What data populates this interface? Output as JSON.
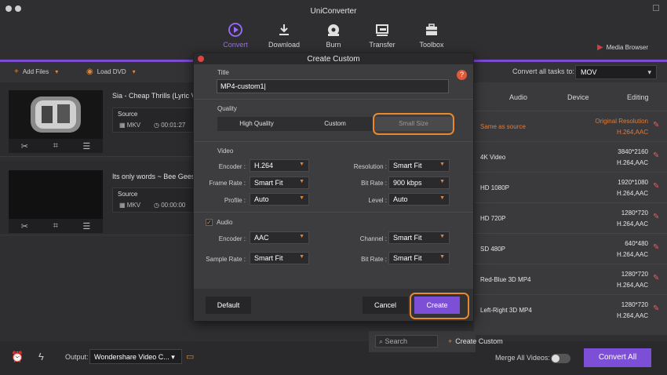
{
  "app": {
    "title": "UniConverter",
    "media_browser": "Media Browser"
  },
  "toolbar": [
    {
      "label": "Convert",
      "icon": "convert-icon",
      "active": true
    },
    {
      "label": "Download",
      "icon": "download-icon",
      "active": false
    },
    {
      "label": "Burn",
      "icon": "burn-icon",
      "active": false
    },
    {
      "label": "Transfer",
      "icon": "transfer-icon",
      "active": false
    },
    {
      "label": "Toolbox",
      "icon": "toolbox-icon",
      "active": false
    }
  ],
  "actionbar": {
    "add_files": "Add Files",
    "load_dvd": "Load DVD",
    "convert_all_label": "Convert all tasks to:",
    "convert_all_value": "MOV"
  },
  "videos": [
    {
      "title": "Sia - Cheap Thrills (Lyric V",
      "source_label": "Source",
      "format": "MKV",
      "duration": "00:01:27"
    },
    {
      "title": "Its only words ~ Bee Gees",
      "source_label": "Source",
      "format": "MKV",
      "duration": "00:00:00"
    }
  ],
  "format_panel": {
    "tabs": [
      "Audio",
      "Device",
      "Editing"
    ],
    "rows": [
      {
        "name": "Same as source",
        "res1": "Original Resolution",
        "res2": "H.264,AAC",
        "highlight": true
      },
      {
        "name": "4K Video",
        "res1": "3840*2160",
        "res2": "H.264,AAC",
        "highlight": false
      },
      {
        "name": "HD 1080P",
        "res1": "1920*1080",
        "res2": "H.264,AAC",
        "highlight": false
      },
      {
        "name": "HD 720P",
        "res1": "1280*720",
        "res2": "H.264,AAC",
        "highlight": false
      },
      {
        "name": "SD 480P",
        "res1": "640*480",
        "res2": "H.264,AAC",
        "highlight": false
      },
      {
        "name": "Red-Blue 3D MP4",
        "res1": "1280*720",
        "res2": "H.264,AAC",
        "highlight": false
      },
      {
        "name": "Left-Right 3D MP4",
        "res1": "1280*720",
        "res2": "H.264,AAC",
        "highlight": false
      }
    ],
    "search_placeholder": "Search",
    "create_custom": "Create Custom"
  },
  "bottombar": {
    "output_label": "Output:",
    "output_value": "Wondershare Video C...",
    "merge_label": "Merge All Videos:",
    "convert_all": "Convert All"
  },
  "modal": {
    "title": "Create Custom",
    "title_label": "Title",
    "title_value": "MP4-custom1",
    "help": "?",
    "quality_label": "Quality",
    "quality_options": [
      "High Quality",
      "Custom",
      "Small Size"
    ],
    "quality_selected": "Small Size",
    "video_label": "Video",
    "encoder_label": "Encoder :",
    "encoder_value": "H.264",
    "resolution_label": "Resolution :",
    "resolution_value": "Smart Fit",
    "frame_rate_label": "Frame Rate :",
    "frame_rate_value": "Smart Fit",
    "bit_rate_label": "Bit Rate :",
    "bit_rate_value": "900 kbps",
    "profile_label": "Profile :",
    "profile_value": "Auto",
    "level_label": "Level :",
    "level_value": "Auto",
    "audio_label": "Audio",
    "audio_checked": "✓",
    "a_encoder_label": "Encoder :",
    "a_encoder_value": "AAC",
    "channel_label": "Channel :",
    "channel_value": "Smart Fit",
    "sample_rate_label": "Sample Rate :",
    "sample_rate_value": "Smart Fit",
    "a_bit_rate_label": "Bit Rate :",
    "a_bit_rate_value": "Smart Fit",
    "default_btn": "Default",
    "cancel_btn": "Cancel",
    "create_btn": "Create"
  },
  "colors": {
    "accent": "#7c4fd6",
    "highlight": "#e8892a"
  }
}
